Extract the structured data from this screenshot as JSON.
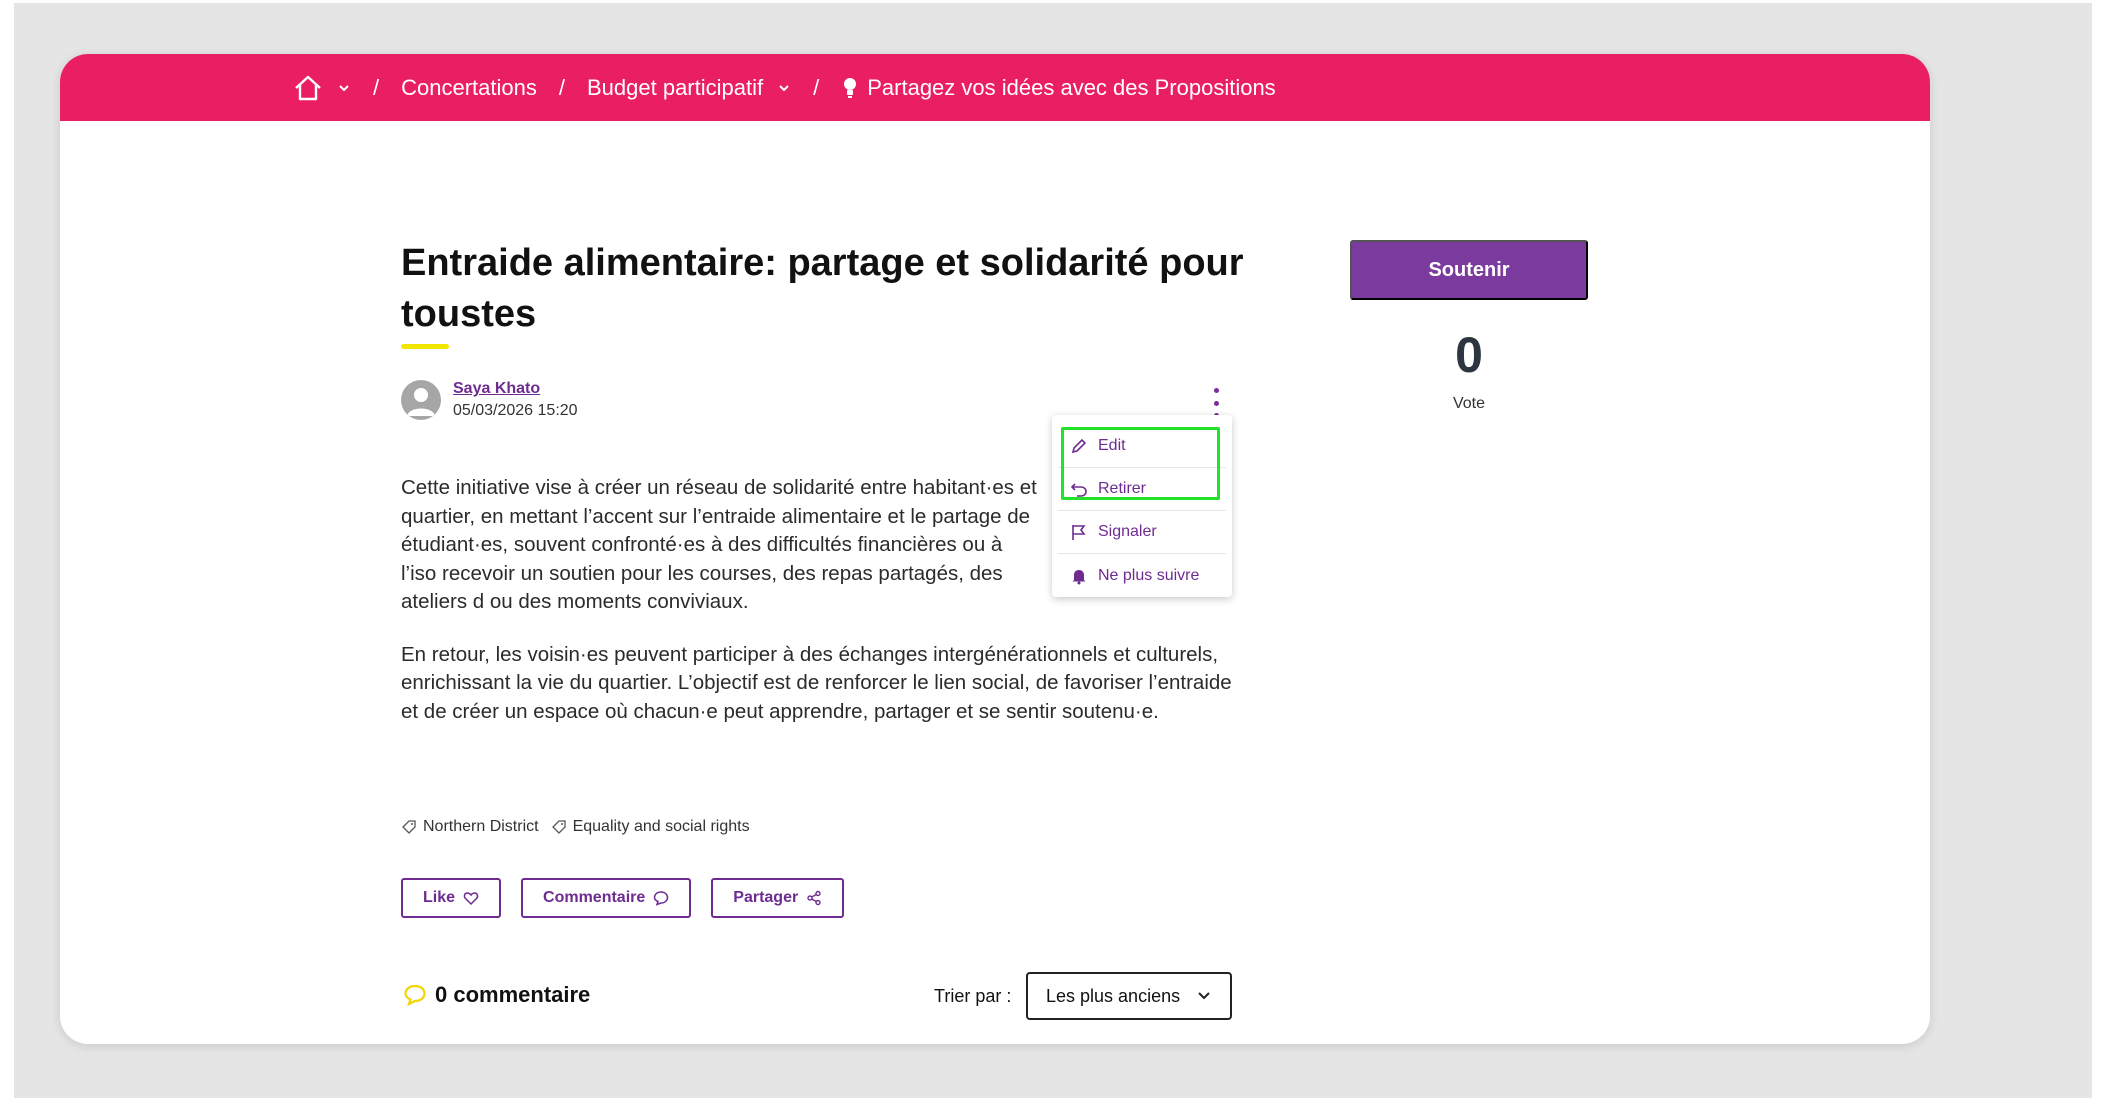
{
  "breadcrumb": {
    "items": [
      "Concertations",
      "Budget participatif",
      "Partagez vos idées avec des Propositions"
    ],
    "separator": "/"
  },
  "proposal": {
    "title": "Entraide alimentaire: partage et solidarité pour toustes",
    "author": "Saya Khato",
    "date": "05/03/2026 15:20",
    "paragraphs": [
      "Cette initiative vise à créer un réseau de solidarité entre habitant·es et quartier, en mettant l’accent sur l’entraide alimentaire et le partage de étudiant·es, souvent confronté·es à des difficultés financières ou à l’iso recevoir un soutien pour les courses, des repas partagés, des ateliers d ou des moments conviviaux.",
      "En retour, les voisin·es peuvent participer à des échanges intergénérationnels et culturels, enrichissant la vie du quartier. L’objectif est de renforcer le lien social, de favoriser l’entraide et de créer un espace où chacun·e peut apprendre, partager et se sentir soutenu·e."
    ],
    "tags": [
      "Northern District",
      "Equality and social rights"
    ]
  },
  "menu": {
    "items": [
      {
        "label": "Edit",
        "icon": "pencil-icon"
      },
      {
        "label": "Retirer",
        "icon": "undo-icon"
      },
      {
        "label": "Signaler",
        "icon": "flag-icon"
      },
      {
        "label": "Ne plus suivre",
        "icon": "bell-icon"
      }
    ]
  },
  "actions": {
    "like": "Like",
    "comment": "Commentaire",
    "share": "Partager"
  },
  "comments": {
    "count_label": "0 commentaire",
    "sort_label": "Trier par :",
    "sort_value": "Les plus anciens"
  },
  "support": {
    "button": "Soutenir",
    "count": "0",
    "label": "Vote"
  },
  "colors": {
    "topbar": "#e91e63",
    "accent": "#6e2c91",
    "support": "#7b3a9d",
    "highlight": "#22e22a"
  }
}
